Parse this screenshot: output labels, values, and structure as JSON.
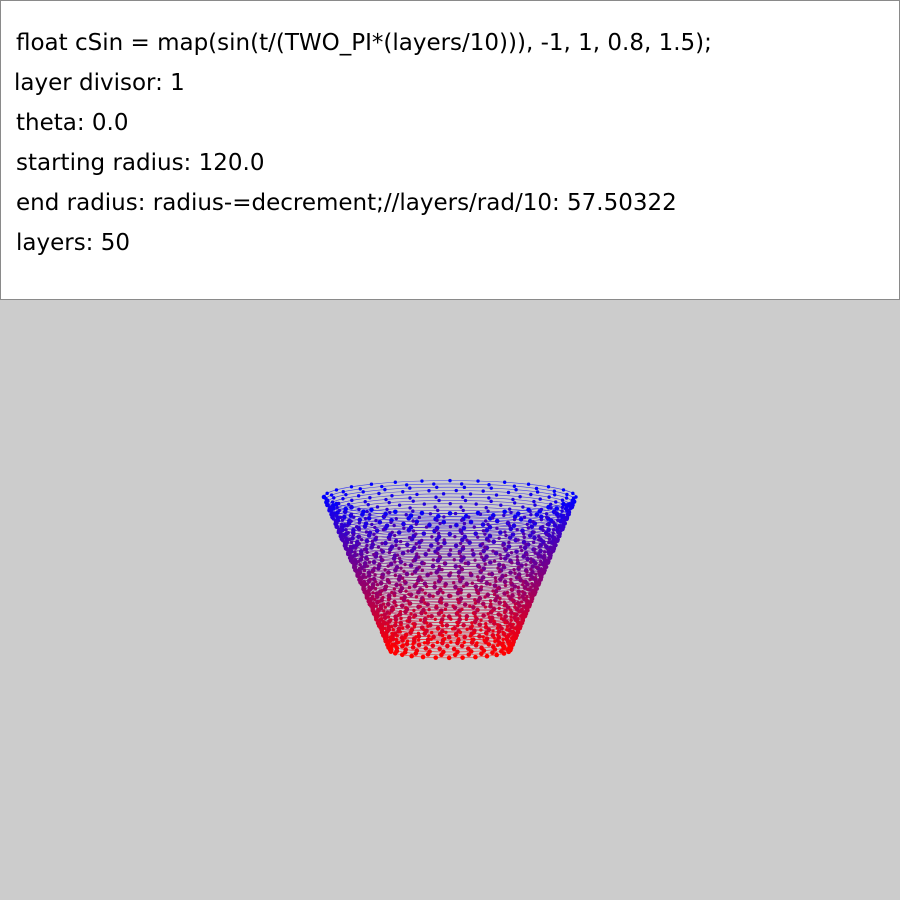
{
  "info": {
    "lines": [
      "float cSin = map(sin(t/(TWO_PI*(layers/10))), -1, 1, 0.8, 1.5);",
      "layer divisor: 1",
      "theta: 0.0",
      "starting radius: 120.0",
      "end radius: radius-=decrement;//layers/rad/10: 57.50322",
      "layers: 50"
    ]
  },
  "sketch": {
    "background_color": "#cccccc",
    "panel_color": "#ffffff",
    "color_top": "#0000ff",
    "color_bottom": "#ff0000",
    "layer_count": 50,
    "start_radius": 120.0,
    "end_radius": 57.50322,
    "theta": 0.0
  }
}
